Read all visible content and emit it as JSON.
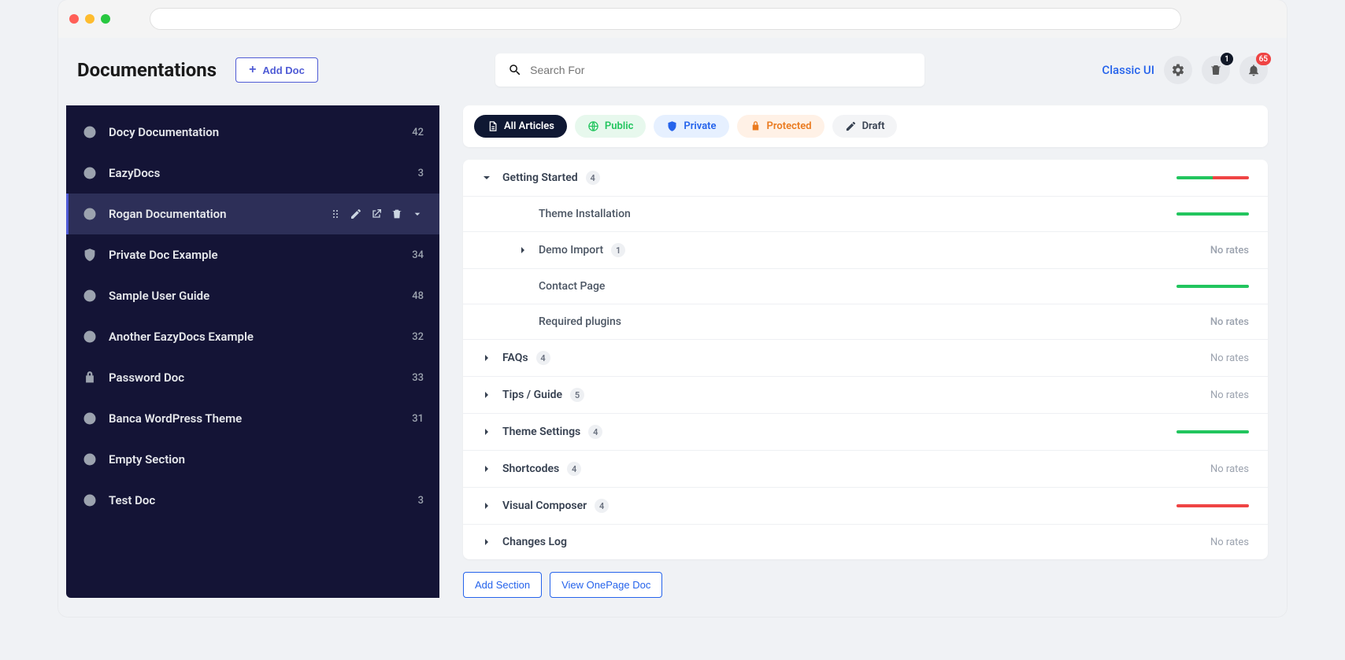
{
  "header": {
    "title": "Documentations",
    "add_doc": "Add Doc",
    "search_placeholder": "Search For",
    "classic_ui": "Classic UI",
    "trash_badge": "1",
    "bell_badge": "65"
  },
  "sidebar": {
    "items": [
      {
        "label": "Docy Documentation",
        "count": "42",
        "icon": "globe"
      },
      {
        "label": "EazyDocs",
        "count": "3",
        "icon": "globe"
      },
      {
        "label": "Rogan Documentation",
        "count": "",
        "icon": "globe",
        "active": true
      },
      {
        "label": "Private Doc Example",
        "count": "34",
        "icon": "shield"
      },
      {
        "label": "Sample User Guide",
        "count": "48",
        "icon": "globe"
      },
      {
        "label": "Another EazyDocs Example",
        "count": "32",
        "icon": "globe"
      },
      {
        "label": "Password Doc",
        "count": "33",
        "icon": "lock"
      },
      {
        "label": "Banca WordPress Theme",
        "count": "31",
        "icon": "globe"
      },
      {
        "label": "Empty Section",
        "count": "",
        "icon": "globe"
      },
      {
        "label": "Test Doc",
        "count": "3",
        "icon": "globe"
      }
    ]
  },
  "filters": {
    "all": "All Articles",
    "public": "Public",
    "private": "Private",
    "protected": "Protected",
    "draft": "Draft"
  },
  "sections": [
    {
      "label": "Getting Started",
      "badge": "4",
      "expanded": true,
      "rate": {
        "g": 50,
        "r": 50
      },
      "children": [
        {
          "label": "Theme Installation",
          "rate": {
            "g": 100,
            "r": 0
          }
        },
        {
          "label": "Demo Import",
          "badge": "1",
          "caret": true,
          "norates": "No rates"
        },
        {
          "label": "Contact Page",
          "rate": {
            "g": 100,
            "r": 0
          }
        },
        {
          "label": "Required plugins",
          "norates": "No rates"
        }
      ]
    },
    {
      "label": "FAQs",
      "badge": "4",
      "norates": "No rates"
    },
    {
      "label": "Tips / Guide",
      "badge": "5",
      "norates": "No rates"
    },
    {
      "label": "Theme Settings",
      "badge": "4",
      "rate": {
        "g": 100,
        "r": 0
      }
    },
    {
      "label": "Shortcodes",
      "badge": "4",
      "norates": "No rates"
    },
    {
      "label": "Visual Composer",
      "badge": "4",
      "rate": {
        "g": 0,
        "r": 100
      }
    },
    {
      "label": "Changes Log",
      "norates": "No rates"
    }
  ],
  "footer": {
    "add_section": "Add Section",
    "view_onepage": "View OnePage Doc"
  }
}
